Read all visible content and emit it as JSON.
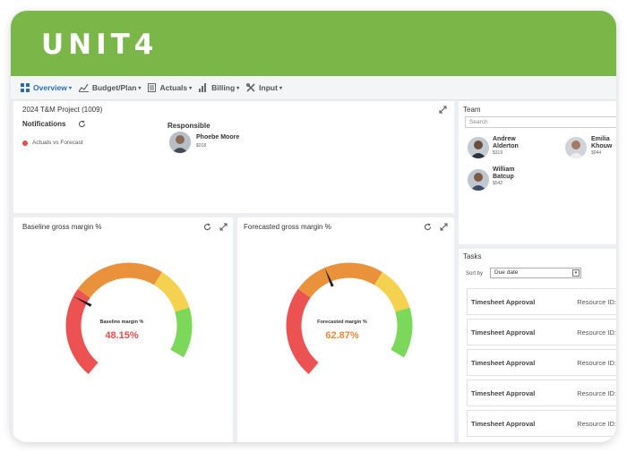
{
  "app": {
    "logo": "UNIT4"
  },
  "nav": {
    "items": [
      {
        "label": "Overview",
        "icon": "grid-icon",
        "active": true
      },
      {
        "label": "Budget/Plan",
        "icon": "chart-icon",
        "active": false
      },
      {
        "label": "Actuals",
        "icon": "document-icon",
        "active": false
      },
      {
        "label": "Billing",
        "icon": "bar-chart-icon",
        "active": false
      },
      {
        "label": "Input",
        "icon": "tools-icon",
        "active": false
      }
    ],
    "caret": "▾"
  },
  "project": {
    "title": "2024 T&M Project (1009)",
    "notifications_label": "Notifications",
    "notification_item": "Actuals vs Forecast",
    "responsible_label": "Responsible",
    "responsible_name": "Phoebe Moore",
    "responsible_id": "$018"
  },
  "team": {
    "title": "Team",
    "search_placeholder": "Search",
    "members": [
      {
        "first": "Andrew",
        "last": "Alderton",
        "id": "$319"
      },
      {
        "first": "Emilia",
        "last": "Khouw",
        "id": "$044"
      },
      {
        "first": "William",
        "last": "Batcup",
        "id": "$542"
      }
    ]
  },
  "gauges": {
    "baseline": {
      "title": "Baseline gross margin %",
      "label": "Baseline margin %",
      "value_text": "48.15%",
      "pointer_fraction": 0.3,
      "value_color": "#e94b4b"
    },
    "forecast": {
      "title": "Forecasted gross margin %",
      "label": "Forecasted margin %",
      "value_text": "62.87%",
      "pointer_fraction": 0.45,
      "value_color": "#e8883a"
    },
    "segment_colors": [
      "#ec5252",
      "#e9913b",
      "#f4d24f",
      "#7bd859"
    ]
  },
  "tasks": {
    "title": "Tasks",
    "sort_label": "Sort by",
    "sort_value": "Due date",
    "items": [
      {
        "title": "Timesheet Approval",
        "resource": "Resource ID:"
      },
      {
        "title": "Timesheet Approval",
        "resource": "Resource ID:"
      },
      {
        "title": "Timesheet Approval",
        "resource": "Resource ID:"
      },
      {
        "title": "Timesheet Approval",
        "resource": "Resource ID:"
      },
      {
        "title": "Timesheet Approval",
        "resource": "Resource ID:"
      }
    ]
  }
}
